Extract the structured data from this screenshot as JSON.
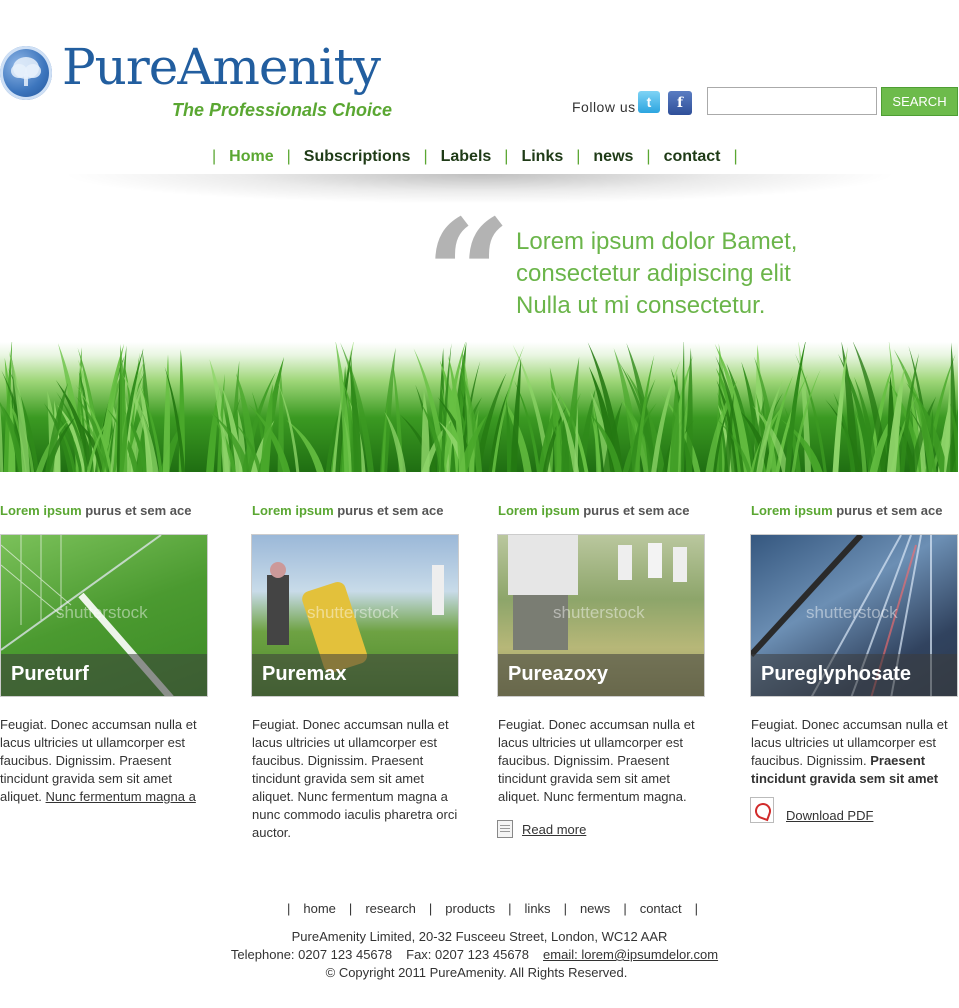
{
  "brand": {
    "title": "PureAmenity",
    "tagline": "The Professionals Choice"
  },
  "header": {
    "follow_label": "Follow us",
    "search_button": "SEARCH",
    "search_value": ""
  },
  "nav": {
    "items": [
      "Home",
      "Subscriptions",
      "Labels",
      "Links",
      "news",
      "contact"
    ],
    "active": "Home"
  },
  "quote": {
    "mark": "“",
    "lines": [
      "Lorem ipsum dolor Bamet,",
      "consectetur adipiscing elit",
      "Nulla ut mi consectetur."
    ]
  },
  "products": [
    {
      "heading_green": "Lorem ipsum",
      "heading_rest": " purus et sem ace",
      "name": "Pureturf",
      "watermark": "shutterstock",
      "text": "Feugiat. Donec accumsan nulla et lacus ultricies ut ullamcorper est faucibus. Dignissim. Praesent tincidunt gravida sem sit amet aliquet. ",
      "link": "Nunc fermentum magna a"
    },
    {
      "heading_green": "Lorem ipsum",
      "heading_rest": " purus et sem ace",
      "name": "Puremax",
      "watermark": "shutterstock",
      "text": "Feugiat. Donec accumsan nulla et lacus ultricies ut ullamcorper est faucibus. Dignissim. Praesent tincidunt gravida sem sit amet aliquet. Nunc fermentum magna a nunc commodo iaculis pharetra orci auctor."
    },
    {
      "heading_green": "Lorem ipsum",
      "heading_rest": " purus et sem ace",
      "name": "Pureazoxy",
      "watermark": "shutterstock",
      "text": "Feugiat. Donec accumsan nulla et lacus ultricies ut ullamcorper est faucibus. Dignissim. Praesent tincidunt gravida sem sit amet aliquet. Nunc fermentum magna.",
      "link": "Read more"
    },
    {
      "heading_green": "Lorem ipsum",
      "heading_rest": " purus et sem ace",
      "name": "Pureglyphosate",
      "watermark": "shutterstock",
      "text": "Feugiat. Donec accumsan nulla et lacus ultricies ut ullamcorper est faucibus. Dignissim. ",
      "text_bold": "Praesent tincidunt gravida sem sit amet",
      "link": "Download PDF"
    }
  ],
  "footer": {
    "nav": [
      "home",
      "research",
      "products",
      "links",
      "news",
      "contact"
    ],
    "address": "PureAmenity Limited, 20-32 Fusceeu Street, London, WC12 AAR",
    "telephone": "Telephone: 0207 123 45678",
    "fax": "Fax: 0207 123 45678",
    "email": "email: lorem@ipsumdelor.com",
    "copyright": "© Copyright 2011 PureAmenity. All Rights Reserved."
  },
  "colors": {
    "brand_blue": "#225e9f",
    "brand_green": "#5aa732",
    "search_button": "#6dbb4b"
  },
  "icons": {
    "logo": "tree-globe-icon",
    "twitter": "twitter-icon",
    "facebook": "facebook-icon",
    "document": "document-icon",
    "pdf": "pdf-icon"
  }
}
